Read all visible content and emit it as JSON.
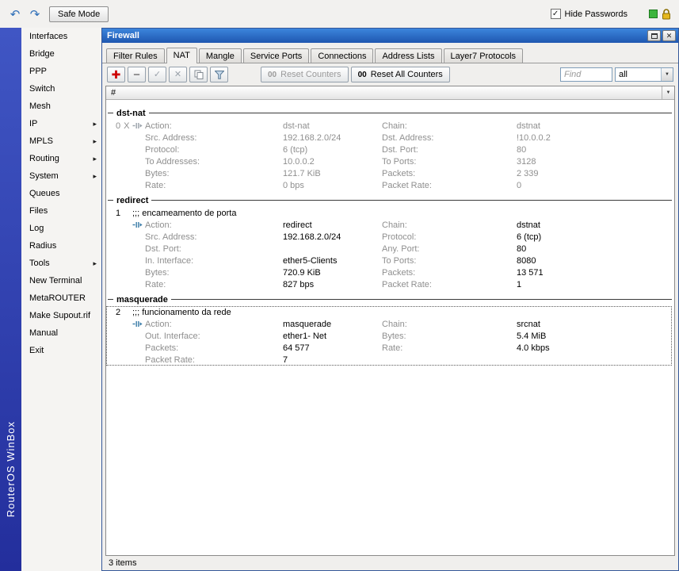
{
  "colors": {
    "titlebar_blue": "#2b6fd0",
    "band_blue": "#3346b4",
    "add_red": "#cc0000",
    "indicator_green": "#3db53d",
    "lock_gold": "#e0b420"
  },
  "topbar": {
    "safe_mode_label": "Safe Mode",
    "hide_passwords_label": "Hide Passwords"
  },
  "brand": {
    "vertical_text": "RouterOS WinBox"
  },
  "sidebar": {
    "items": [
      {
        "label": "Interfaces",
        "arrow": false
      },
      {
        "label": "Bridge",
        "arrow": false
      },
      {
        "label": "PPP",
        "arrow": false
      },
      {
        "label": "Switch",
        "arrow": false
      },
      {
        "label": "Mesh",
        "arrow": false
      },
      {
        "label": "IP",
        "arrow": true
      },
      {
        "label": "MPLS",
        "arrow": true
      },
      {
        "label": "Routing",
        "arrow": true
      },
      {
        "label": "System",
        "arrow": true
      },
      {
        "label": "Queues",
        "arrow": false
      },
      {
        "label": "Files",
        "arrow": false
      },
      {
        "label": "Log",
        "arrow": false
      },
      {
        "label": "Radius",
        "arrow": false
      },
      {
        "label": "Tools",
        "arrow": true
      },
      {
        "label": "New Terminal",
        "arrow": false
      },
      {
        "label": "MetaROUTER",
        "arrow": false
      },
      {
        "label": "Make Supout.rif",
        "arrow": false
      },
      {
        "label": "Manual",
        "arrow": false
      },
      {
        "label": "Exit",
        "arrow": false
      }
    ]
  },
  "window": {
    "title": "Firewall",
    "tabs": [
      {
        "label": "Filter Rules",
        "active": false
      },
      {
        "label": "NAT",
        "active": true
      },
      {
        "label": "Mangle",
        "active": false
      },
      {
        "label": "Service Ports",
        "active": false
      },
      {
        "label": "Connections",
        "active": false
      },
      {
        "label": "Address Lists",
        "active": false
      },
      {
        "label": "Layer7 Protocols",
        "active": false
      }
    ],
    "toolbar": {
      "reset_counters_label": "Reset Counters",
      "reset_counters_icon": "00",
      "reset_all_counters_label": "Reset All Counters",
      "reset_all_counters_icon": "00",
      "find_placeholder": "Find",
      "filter_selected": "all"
    },
    "list": {
      "number_column_header": "#",
      "status": "3 items"
    }
  },
  "rules": [
    {
      "section": "dst-nat",
      "number": "0",
      "flag": "X",
      "disabled": true,
      "selected": false,
      "comment": "",
      "lines": [
        {
          "l1": "Action:",
          "v1": "dst-nat",
          "l2": "Chain:",
          "v2": "dstnat"
        },
        {
          "l1": "Src. Address:",
          "v1": "192.168.2.0/24",
          "l2": "Dst. Address:",
          "v2": "!10.0.0.2"
        },
        {
          "l1": "Protocol:",
          "v1": "6 (tcp)",
          "l2": "Dst. Port:",
          "v2": "80"
        },
        {
          "l1": "To Addresses:",
          "v1": "10.0.0.2",
          "l2": "To Ports:",
          "v2": "3128"
        },
        {
          "l1": "Bytes:",
          "v1": "121.7 KiB",
          "l2": "Packets:",
          "v2": "2 339"
        },
        {
          "l1": "Rate:",
          "v1": "0 bps",
          "l2": "Packet Rate:",
          "v2": "0"
        }
      ]
    },
    {
      "section": "redirect",
      "number": "1",
      "flag": "",
      "disabled": false,
      "selected": false,
      "comment": ";;; encameamento de porta",
      "lines": [
        {
          "l1": "Action:",
          "v1": "redirect",
          "l2": "Chain:",
          "v2": "dstnat"
        },
        {
          "l1": "Src. Address:",
          "v1": "192.168.2.0/24",
          "l2": "Protocol:",
          "v2": "6 (tcp)"
        },
        {
          "l1": "Dst. Port:",
          "v1": "",
          "l2": "Any. Port:",
          "v2": "80"
        },
        {
          "l1": "In. Interface:",
          "v1": "ether5-Clients",
          "l2": "To Ports:",
          "v2": "8080"
        },
        {
          "l1": "Bytes:",
          "v1": "720.9 KiB",
          "l2": "Packets:",
          "v2": "13 571"
        },
        {
          "l1": "Rate:",
          "v1": "827 bps",
          "l2": "Packet Rate:",
          "v2": "1"
        }
      ]
    },
    {
      "section": "masquerade",
      "number": "2",
      "flag": "",
      "disabled": false,
      "selected": true,
      "comment": ";;; funcionamento da rede",
      "lines": [
        {
          "l1": "Action:",
          "v1": "masquerade",
          "l2": "Chain:",
          "v2": "srcnat"
        },
        {
          "l1": "Out. Interface:",
          "v1": "ether1- Net",
          "l2": "Bytes:",
          "v2": "5.4 MiB"
        },
        {
          "l1": "Packets:",
          "v1": "64 577",
          "l2": "Rate:",
          "v2": "4.0 kbps"
        },
        {
          "l1": "Packet Rate:",
          "v1": "7",
          "l2": "",
          "v2": ""
        }
      ]
    }
  ]
}
